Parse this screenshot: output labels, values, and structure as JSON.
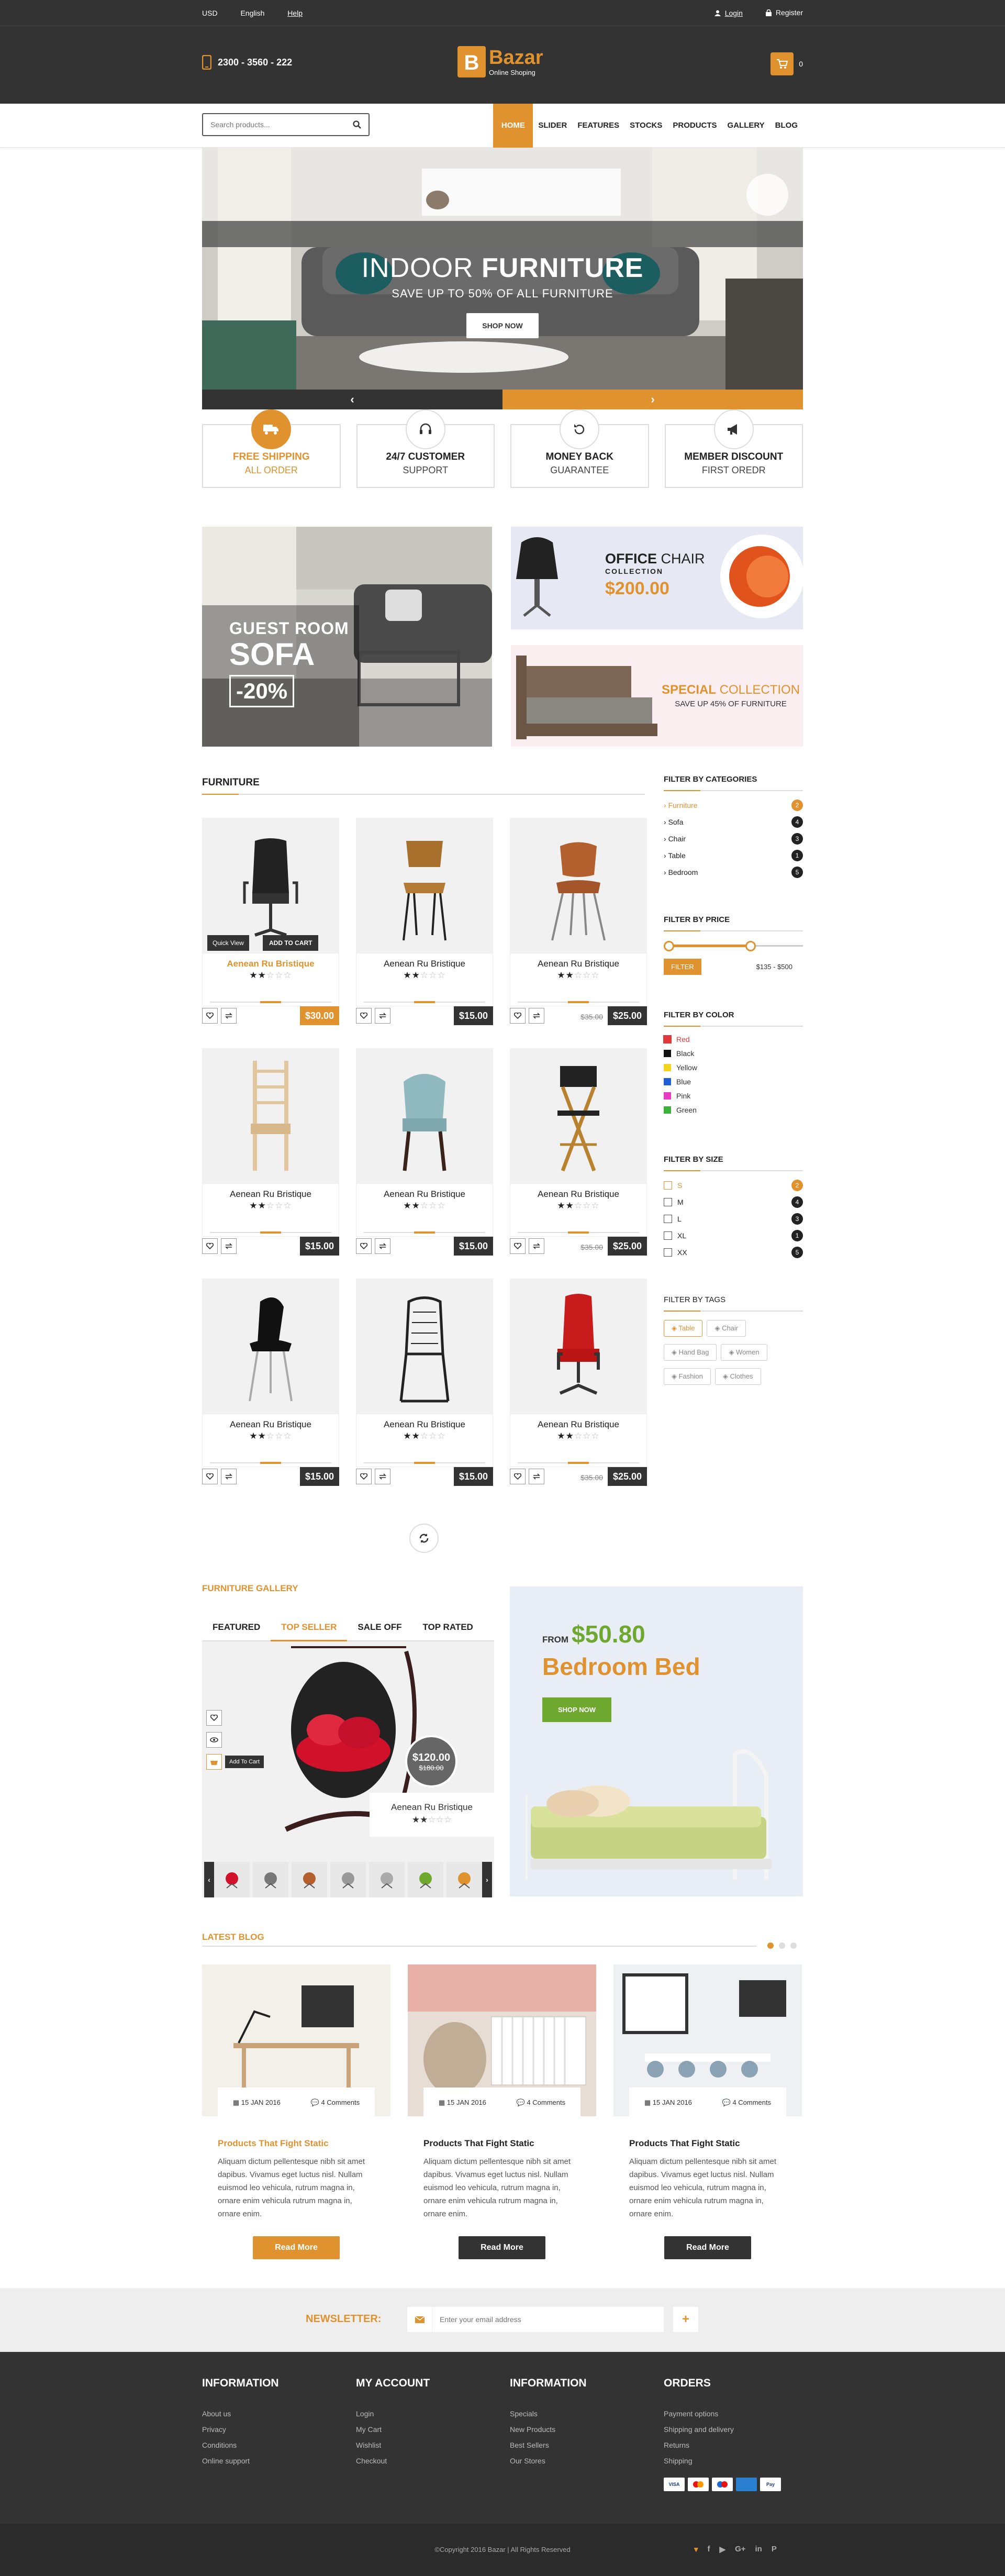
{
  "topbar": {
    "currency": "USD",
    "language": "English",
    "help": "Help",
    "login": "Login",
    "register": "Register",
    "phone": "2300 - 3560 - 222",
    "logo_letter": "B",
    "logo_name": "Bazar",
    "logo_tagline": "Online Shoping",
    "cart_count": "0"
  },
  "nav": {
    "search_placeholder": "Search products...",
    "items": [
      "HOME",
      "SLIDER",
      "FEATURES",
      "STOCKS",
      "PRODUCTS",
      "GALLERY",
      "BLOG"
    ]
  },
  "slider": {
    "title_light": "INDOOR ",
    "title_bold": "FURNITURE",
    "subtitle": "SAVE UP TO 50% OF ALL FURNITURE",
    "button": "SHOP NOW",
    "prev": "‹",
    "next": "›"
  },
  "features": [
    {
      "line1": "FREE SHIPPING",
      "line2": "ALL ORDER"
    },
    {
      "line1": "24/7 CUSTOMER",
      "line2": "SUPPORT"
    },
    {
      "line1": "MONEY BACK",
      "line2": "GUARANTEE"
    },
    {
      "line1": "MEMBER DISCOUNT",
      "line2": "FIRST OREDR"
    }
  ],
  "banners": {
    "sofa_small": "GUEST ROOM",
    "sofa_big": "SOFA",
    "sofa_off": "-20%",
    "chair_title_b": "OFFICE",
    "chair_title": " CHAIR",
    "chair_sub": "COLLECTION",
    "chair_price": "$200.00",
    "special_b": "SPECIAL",
    "special": " COLLECTION",
    "special_sub": "SAVE UP 45% OF FURNITURE"
  },
  "products": {
    "title": "FURNITURE",
    "quick_view": "Quick View",
    "add_to_cart": "ADD TO CART",
    "items": [
      {
        "name": "Aenean Ru Bristique",
        "price": "$30.00",
        "old": "",
        "stars": 2
      },
      {
        "name": "Aenean Ru Bristique",
        "price": "$15.00",
        "old": "",
        "stars": 2
      },
      {
        "name": "Aenean Ru Bristique",
        "price": "$25.00",
        "old": "$35.00",
        "stars": 2
      },
      {
        "name": "Aenean Ru Bristique",
        "price": "$15.00",
        "old": "",
        "stars": 2
      },
      {
        "name": "Aenean Ru Bristique",
        "price": "$15.00",
        "old": "",
        "stars": 2
      },
      {
        "name": "Aenean Ru Bristique",
        "price": "$25.00",
        "old": "$35.00",
        "stars": 2
      },
      {
        "name": "Aenean Ru Bristique",
        "price": "$15.00",
        "old": "",
        "stars": 2
      },
      {
        "name": "Aenean Ru Bristique",
        "price": "$15.00",
        "old": "",
        "stars": 2
      },
      {
        "name": "Aenean Ru Bristique",
        "price": "$25.00",
        "old": "$35.00",
        "stars": 2
      }
    ]
  },
  "sidebar": {
    "cat_title": "FILTER BY CATEGORIES",
    "categories": [
      {
        "name": "Furniture",
        "n": "2"
      },
      {
        "name": "Sofa",
        "n": "4"
      },
      {
        "name": "Chair",
        "n": "3"
      },
      {
        "name": "Table",
        "n": "1"
      },
      {
        "name": "Bedroom",
        "n": "5"
      }
    ],
    "price_title": "FILTER BY PRICE",
    "filter_btn": "FILTER",
    "price_range": "$135 - $500",
    "color_title": "FILTER BY COLOR",
    "colors": [
      {
        "name": "Red",
        "hex": "#e23a3a"
      },
      {
        "name": "Black",
        "hex": "#111111"
      },
      {
        "name": "Yellow",
        "hex": "#f2d51c"
      },
      {
        "name": "Blue",
        "hex": "#1e5fd6"
      },
      {
        "name": "Pink",
        "hex": "#e83cc4"
      },
      {
        "name": "Green",
        "hex": "#3bb33b"
      }
    ],
    "size_title": "FILTER BY SIZE",
    "sizes": [
      {
        "name": "S",
        "n": "2"
      },
      {
        "name": "M",
        "n": "4"
      },
      {
        "name": "L",
        "n": "3"
      },
      {
        "name": "XL",
        "n": "1"
      },
      {
        "name": "XX",
        "n": "5"
      }
    ],
    "tags_title": "FILTER BY TAGS",
    "tags": [
      "Table",
      "Chair",
      "Hand Bag",
      "Women",
      "Fashion",
      "Clothes"
    ]
  },
  "gallery": {
    "title": "FURNITURE GALLERY",
    "tabs": [
      "FEATURED",
      "TOP SELLER",
      "SALE OFF",
      "TOP RATED"
    ],
    "price": "$120.00",
    "old": "$180.00",
    "add_to_cart": "Add To Cart",
    "name": "Aenean Ru Bristique",
    "promo_from": "FROM",
    "promo_price": "$50.80",
    "promo_title": "Bedroom Bed",
    "promo_btn": "SHOP NOW"
  },
  "blog": {
    "title": "LATEST BLOG",
    "posts": [
      {
        "date": "15 JAN 2016",
        "comments": "4 Comments",
        "title": "Products That Fight Static",
        "text": "Aliquam dictum pellentesque nibh sit amet dapibus. Vivamus eget luctus nisl. Nullam euismod leo vehicula, rutrum magna in, ornare enim vehicula rutrum magna in, ornare enim.",
        "btn": "Read More"
      },
      {
        "date": "15 JAN 2016",
        "comments": "4 Comments",
        "title": "Products That Fight Static",
        "text": "Aliquam dictum pellentesque nibh sit amet dapibus. Vivamus eget luctus nisl. Nullam euismod leo vehicula, rutrum magna in, ornare enim vehicula rutrum magna in, ornare enim.",
        "btn": "Read More"
      },
      {
        "date": "15 JAN 2016",
        "comments": "4 Comments",
        "title": "Products That Fight Static",
        "text": "Aliquam dictum pellentesque nibh sit amet dapibus. Vivamus eget luctus nisl. Nullam euismod leo vehicula, rutrum magna in, ornare enim vehicula rutrum magna in, ornare enim.",
        "btn": "Read More"
      }
    ]
  },
  "newsletter": {
    "label": "NEWSLETTER:",
    "placeholder": "Enter your email address",
    "btn": "+"
  },
  "footer": {
    "cols": [
      {
        "title": "INFORMATION",
        "links": [
          "About us",
          "Privacy",
          "Conditions",
          "Online support"
        ]
      },
      {
        "title": "MY ACCOUNT",
        "links": [
          "Login",
          "My Cart",
          "Wishlist",
          "Checkout"
        ]
      },
      {
        "title": "INFORMATION",
        "links": [
          "Specials",
          "New Products",
          "Best Sellers",
          "Our Stores"
        ]
      },
      {
        "title": "ORDERS",
        "links": [
          "Payment options",
          "Shipping and delivery",
          "Returns",
          "Shipping"
        ]
      }
    ],
    "copyright": "©Copyright 2016 Bazar | All Rights Reserved",
    "social": [
      "twitter",
      "facebook",
      "youtube",
      "google-plus",
      "linkedin",
      "pinterest"
    ]
  },
  "colors": {
    "accent": "#e0922f",
    "dark": "#333333",
    "footer": "#333333"
  }
}
